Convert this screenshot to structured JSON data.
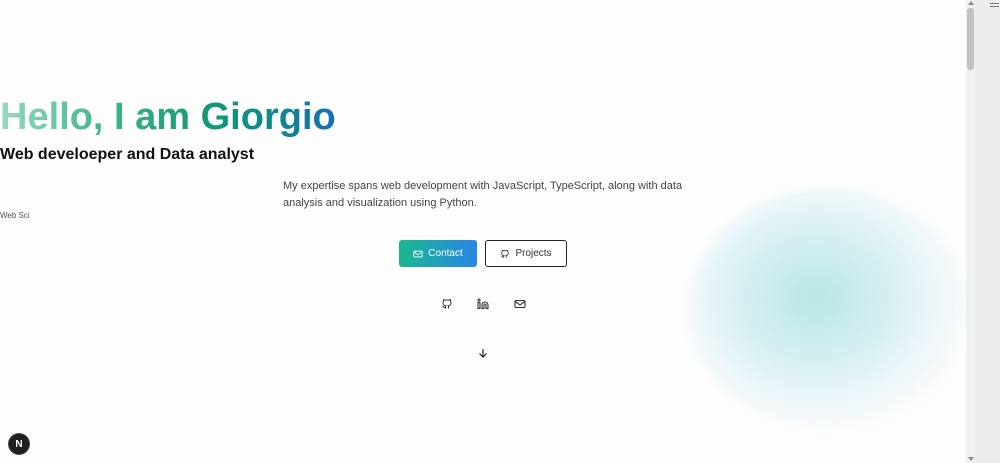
{
  "hero": {
    "title": "Hello, I am Giorgio",
    "subtitle": "Web develoeper and Data analyst",
    "description": "My expertise spans web development with JavaScript, TypeScript, along with data analysis and visualization using Python.",
    "tag": "Web Sci"
  },
  "buttons": {
    "contact_label": "Contact",
    "projects_label": "Projects"
  },
  "socials": [
    "github-icon",
    "linkedin-icon",
    "mail-icon"
  ],
  "scroll_hint": "arrow-down-icon",
  "badge": {
    "letter": "N"
  },
  "colors": {
    "title_gradient": [
      "#9ad8c4",
      "#3fb58a",
      "#169a73",
      "#1a6fb5"
    ],
    "contact_gradient": [
      "#18b98e",
      "#2a86e6"
    ],
    "blob": "#aee1e1"
  }
}
